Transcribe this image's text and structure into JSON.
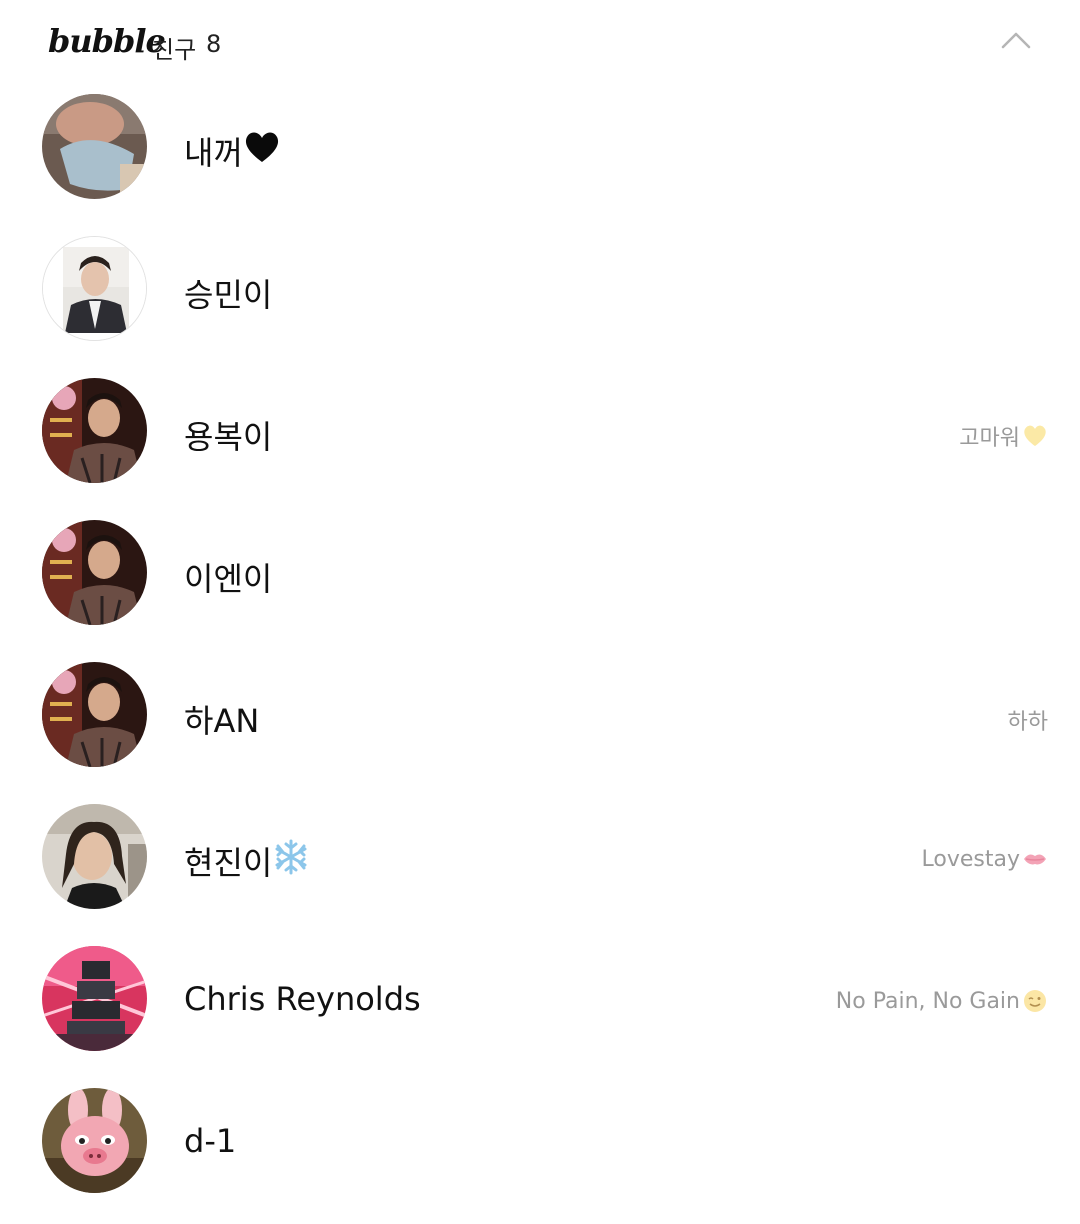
{
  "header": {
    "logo": "bubble",
    "friends_label": "친구",
    "friends_count": "8",
    "collapse_icon": "chevron-up-icon"
  },
  "friends": [
    {
      "name": "내꺼",
      "name_emoji": "black-heart-icon",
      "status": "",
      "status_emoji": ""
    },
    {
      "name": "승민이",
      "name_emoji": "",
      "status": "",
      "status_emoji": ""
    },
    {
      "name": "용복이",
      "name_emoji": "",
      "status": "고마워",
      "status_emoji": "yellow-heart-icon"
    },
    {
      "name": "이엔이",
      "name_emoji": "",
      "status": "",
      "status_emoji": ""
    },
    {
      "name": "하AN",
      "name_emoji": "",
      "status": "하하",
      "status_emoji": ""
    },
    {
      "name": "현진이",
      "name_emoji": "snowflake-icon",
      "status": "Lovestay",
      "status_emoji": "kiss-mark-icon"
    },
    {
      "name": "Chris Reynolds",
      "name_emoji": "",
      "status": "No Pain, No Gain",
      "status_emoji": "winking-face-icon"
    },
    {
      "name": "d-1",
      "name_emoji": "",
      "status": "",
      "status_emoji": ""
    }
  ],
  "colors": {
    "status_text": "#9a9a9a",
    "name_text": "#111111",
    "background": "#ffffff"
  }
}
